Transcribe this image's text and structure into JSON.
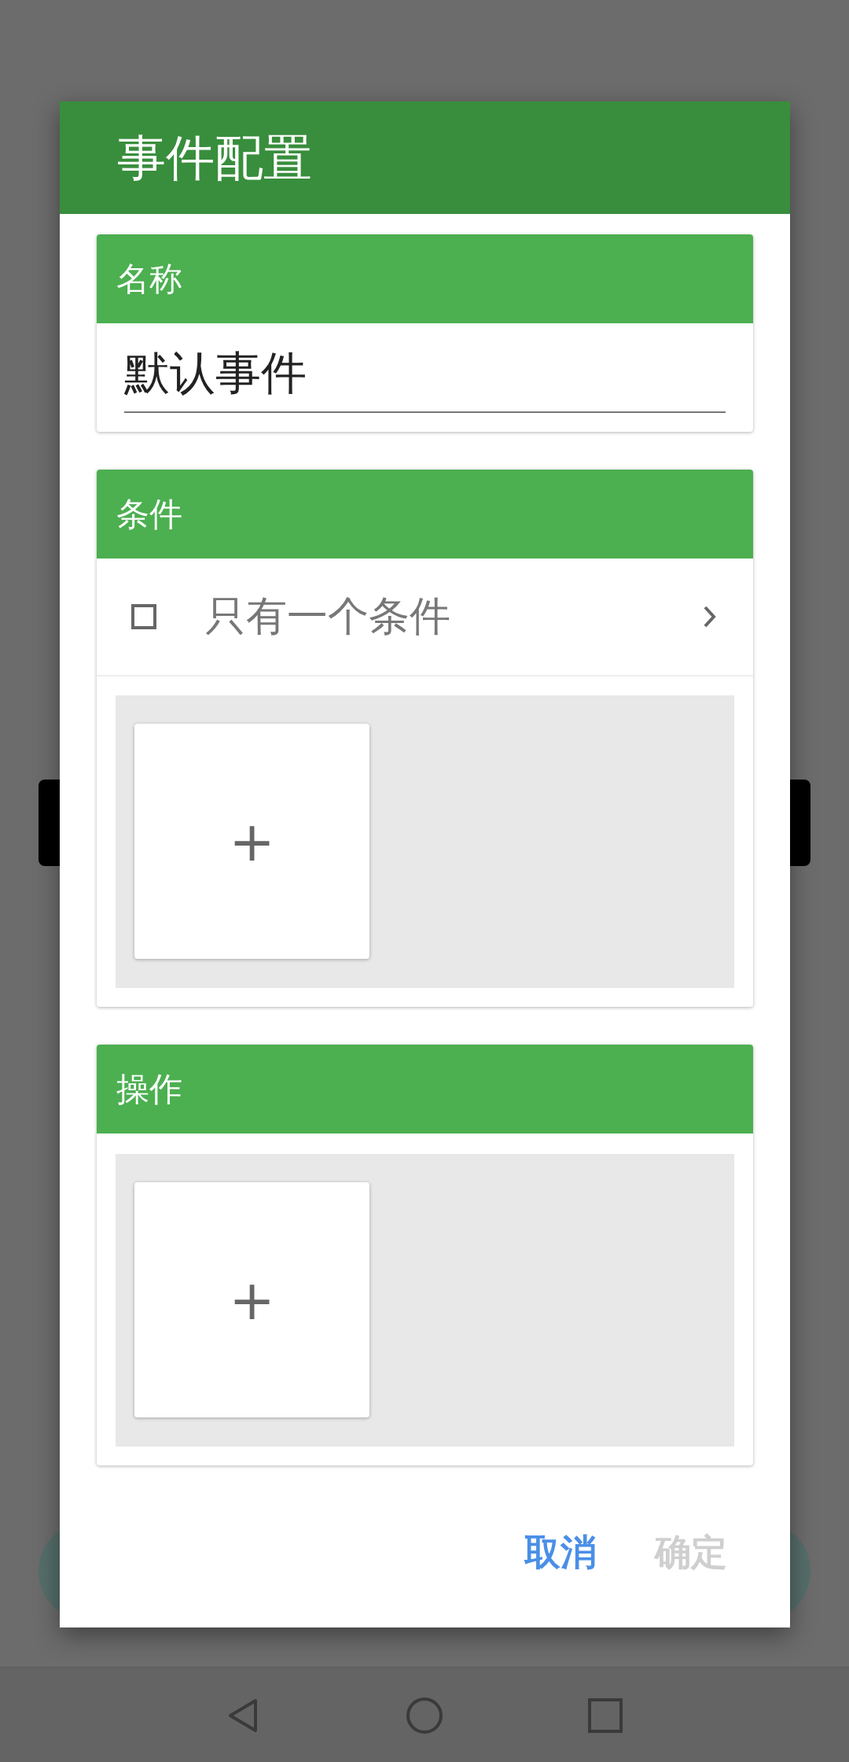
{
  "dialog": {
    "title": "事件配置",
    "sections": [
      {
        "kind": "name",
        "header": "名称",
        "value": "默认事件"
      },
      {
        "kind": "conditions",
        "header": "条件",
        "option": {
          "label": "只有一个条件",
          "checked": false
        },
        "tiles": [
          {
            "label": "+"
          }
        ]
      },
      {
        "kind": "actions",
        "header": "操作",
        "tiles": [
          {
            "label": "+"
          }
        ]
      }
    ],
    "buttons": [
      {
        "label": "取消",
        "disabled": false
      },
      {
        "label": "确定",
        "disabled": true
      }
    ]
  }
}
